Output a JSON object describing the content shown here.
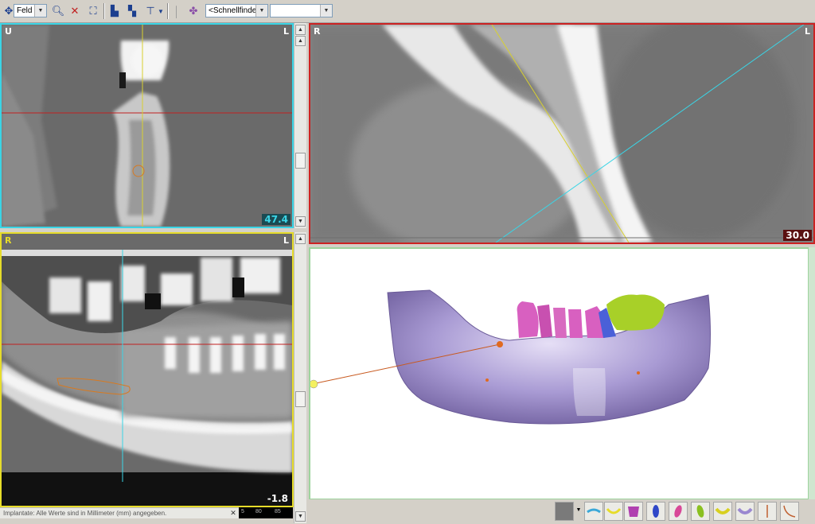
{
  "toolbar": {
    "mode_select": "Feld",
    "quick_finder": "<Schnellfinder>",
    "second_select": ""
  },
  "panels": {
    "cross": {
      "corner_left": "U",
      "corner_right": "L",
      "readout": "47.4",
      "frame_color": "#3ad5e6"
    },
    "detail": {
      "corner_left": "R",
      "corner_right": "L",
      "readout": "30.0",
      "frame_color": "#cc2222"
    },
    "panoramic": {
      "corner_left": "R",
      "corner_right": "L",
      "readout": "-1.8",
      "frame_color": "#e6dc2a"
    },
    "model3d": {
      "frame_color": "#9ed49e"
    }
  },
  "status": {
    "message": "Implantate: Alle Werte sind in Millimeter (mm) angegeben.",
    "ruler_ticks": [
      "5",
      "80",
      "85"
    ]
  },
  "icons": [
    "move-icon",
    "zoom-icon",
    "zoom-reset-icon",
    "fit-icon",
    "layout-icon",
    "measure-icon",
    "implant-icon",
    "slice-icon",
    "navigator-icon"
  ],
  "objects": [
    "head-icon",
    "nerve-icon",
    "jaw-icon",
    "teeth-icon",
    "tooth-blue-icon",
    "tooth-pink-icon",
    "tooth-green-icon",
    "jaw-yellow-icon",
    "jaw-purple-icon",
    "canal-icon",
    "canal-curve-icon"
  ],
  "colors": {
    "bone": "#a99bd4",
    "teeth_pink": "#d860c0",
    "teeth_green": "#a8d028",
    "tooth_blue": "#4a60d8"
  }
}
